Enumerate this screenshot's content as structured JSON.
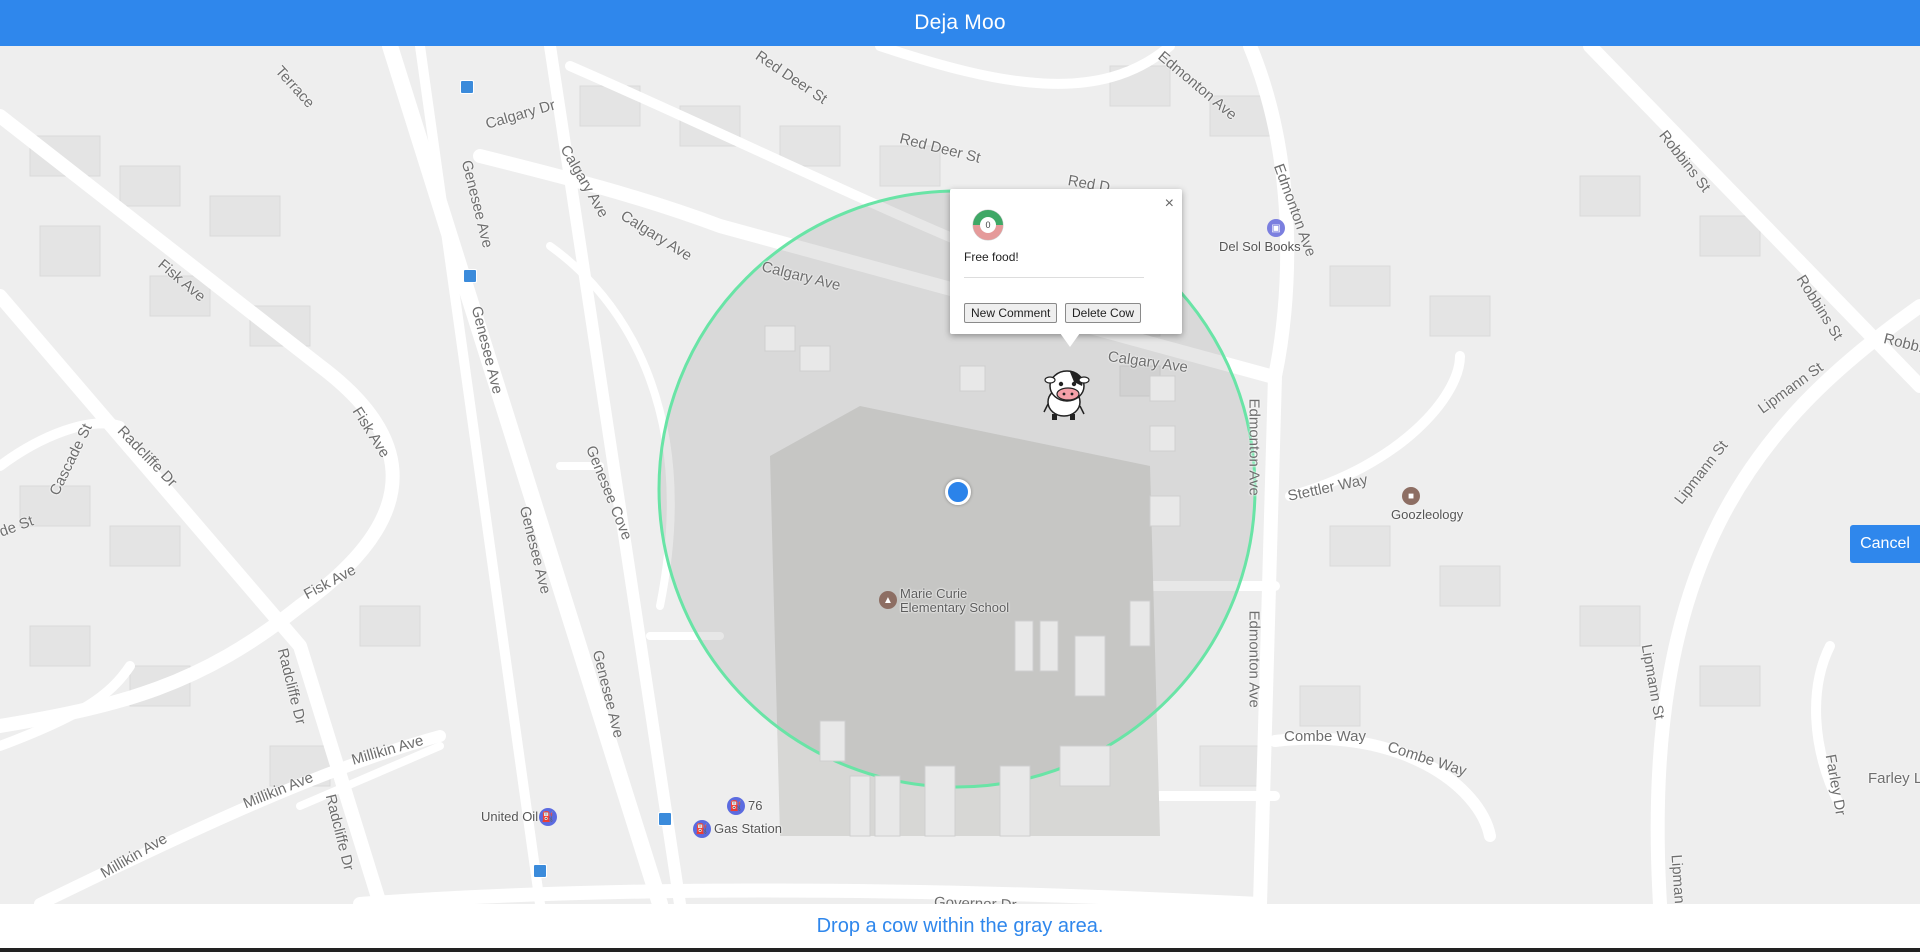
{
  "app": {
    "title": "Deja Moo"
  },
  "map": {
    "streets": [
      {
        "name": "Terrace"
      },
      {
        "name": "Calgary Dr"
      },
      {
        "name": "Red Deer St"
      },
      {
        "name": "Red Deer St"
      },
      {
        "name": "Red D..."
      },
      {
        "name": "Edmonton Ave"
      },
      {
        "name": "Edmonton Ave"
      },
      {
        "name": "Robbins St"
      },
      {
        "name": "Robbins St"
      },
      {
        "name": "Robb..."
      },
      {
        "name": "Calgary Ave"
      },
      {
        "name": "Calgary Ave"
      },
      {
        "name": "Calgary Ave"
      },
      {
        "name": "Calgary Ave"
      },
      {
        "name": "Genesee Ave"
      },
      {
        "name": "Genesee Ave"
      },
      {
        "name": "Genesee Ave"
      },
      {
        "name": "Genesee Ave"
      },
      {
        "name": "Genesee Cove"
      },
      {
        "name": "Fisk Ave"
      },
      {
        "name": "Fisk Ave"
      },
      {
        "name": "Fisk Ave"
      },
      {
        "name": "Radcliffe Dr"
      },
      {
        "name": "Radcliffe Dr"
      },
      {
        "name": "Radcliffe Dr"
      },
      {
        "name": "Cascade St"
      },
      {
        "name": "de St"
      },
      {
        "name": "Millikin Ave"
      },
      {
        "name": "Millikin Ave"
      },
      {
        "name": "Millikin Ave"
      },
      {
        "name": "Edmonton Ave"
      },
      {
        "name": "Edmonton Ave"
      },
      {
        "name": "Stettler Way"
      },
      {
        "name": "Lipmann St"
      },
      {
        "name": "Lipmann St"
      },
      {
        "name": "Lipmann St"
      },
      {
        "name": "Lipmann St"
      },
      {
        "name": "Combe Way"
      },
      {
        "name": "Combe Way"
      },
      {
        "name": "Farley Dr"
      },
      {
        "name": "Farley Ln"
      },
      {
        "name": "Governor Dr"
      }
    ],
    "pois": {
      "del_sol_books": "Del Sol Books",
      "goozleology": "Goozleology",
      "school_line1": "Marie Curie",
      "school_line2": "Elementary School",
      "united_oil": "United Oil",
      "station_76": "76",
      "gas_station": "Gas Station"
    },
    "area_color": "#69e4a6"
  },
  "info_window": {
    "avatar_count": "0",
    "text": "Free food!",
    "new_comment_label": "New Comment",
    "delete_cow_label": "Delete Cow",
    "close_symbol": "×"
  },
  "controls": {
    "cancel_label": "Cancel",
    "zoom_in_symbol": "+"
  },
  "footer": {
    "instruction": "Drop a cow within the gray area."
  }
}
